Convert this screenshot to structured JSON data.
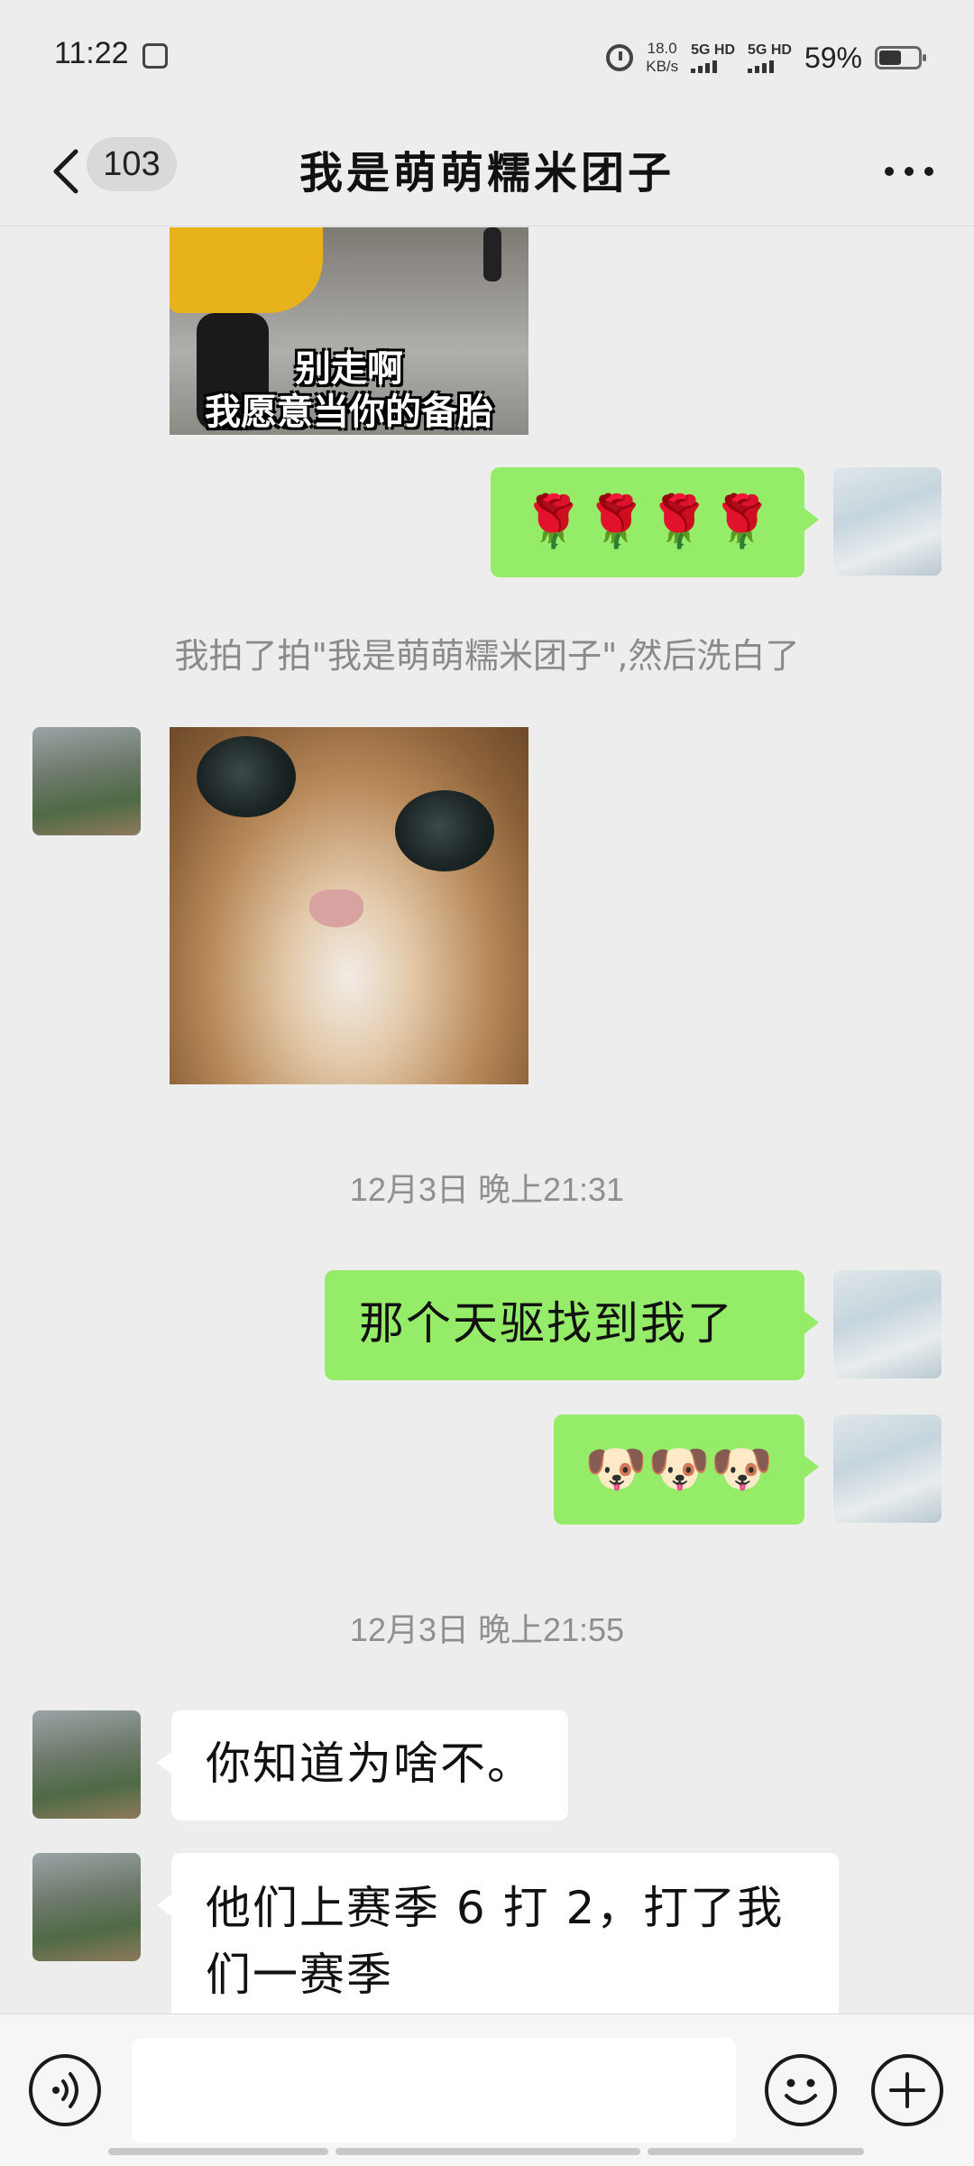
{
  "status_bar": {
    "time": "11:22",
    "net_speed_value": "18.0",
    "net_speed_unit": "KB/s",
    "signal_1": "5G HD",
    "signal_2": "5G HD",
    "battery": "59%"
  },
  "header": {
    "unread_count": "103",
    "title": "我是萌萌糯米团子"
  },
  "messages": {
    "meme_line1": "别走啊",
    "meme_line2": "我愿意当你的备胎",
    "roses": "🌹🌹🌹🌹",
    "pat_notice": "我拍了拍\"我是萌萌糯米团子\",然后洗白了",
    "time_1": "12月3日 晚上21:31",
    "msg_1": "那个天驱找到我了",
    "doge": "🐶🐶🐶",
    "time_2": "12月3日 晚上21:55",
    "msg_2": "你知道为啥不。",
    "msg_3": "他们上赛季 6 打 2，打了我们一赛季"
  },
  "input": {
    "placeholder": ""
  },
  "colors": {
    "sent_bubble": "#95ec69",
    "received_bubble": "#ffffff",
    "background": "#ededed"
  }
}
